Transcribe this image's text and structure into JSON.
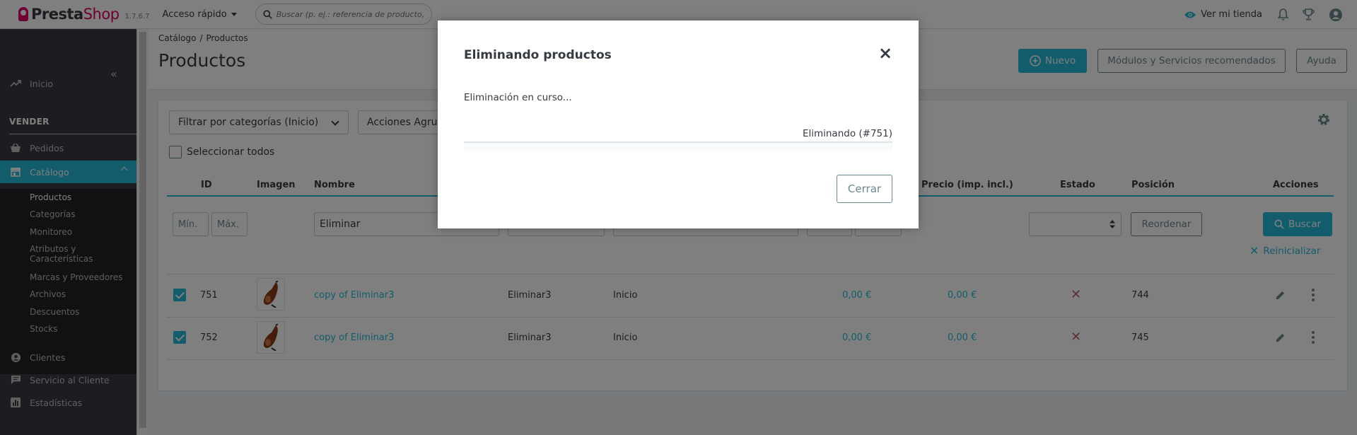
{
  "header": {
    "logo_presta": "Presta",
    "logo_shop": "Shop",
    "version": "1.7.6.7",
    "quick_access": "Acceso rápido",
    "search_placeholder": "Buscar (p. ej.: referencia de producto, n",
    "view_store": "Ver mi tienda"
  },
  "sidebar": {
    "home": "Inicio",
    "section_sell": "VENDER",
    "orders": "Pedidos",
    "catalog": "Catálogo",
    "catalog_sub": [
      "Productos",
      "Categorías",
      "Monitoreo",
      "Atributos y",
      "Características",
      "Marcas y Proveedores",
      "Archivos",
      "Descuentos",
      "Stocks"
    ],
    "customers": "Clientes",
    "customer_service": "Servicio al Cliente",
    "stats": "Estadísticas"
  },
  "page": {
    "breadcrumb": [
      "Catálogo",
      "Productos"
    ],
    "breadcrumb_sep": "/",
    "title": "Productos",
    "new_button": "Nuevo",
    "modules_button": "Módulos y Servicios recomendados",
    "help_button": "Ayuda"
  },
  "toolbar": {
    "category_filter": "Filtrar por categorías (Inicio)",
    "bulk_actions": "Acciones Agrup",
    "select_all": "Seleccionar todos"
  },
  "table": {
    "columns": {
      "id": "ID",
      "image": "Imagen",
      "name": "Nombre",
      "price_incl": "Precio (imp. incl.)",
      "status": "Estado",
      "position": "Posición",
      "actions": "Acciones"
    },
    "filters": {
      "id_min": "Mín.",
      "id_max": "Máx.",
      "name_value": "Eliminar",
      "reorder_button": "Reordenar",
      "search_button": "Buscar",
      "reset_link": "Reinicializar"
    },
    "rows": [
      {
        "id": "751",
        "name": "copy of Eliminar3",
        "reference": "Eliminar3",
        "category": "Inicio",
        "price": "0,00 €",
        "price_incl": "0,00 €",
        "position": "744"
      },
      {
        "id": "752",
        "name": "copy of Eliminar3",
        "reference": "Eliminar3",
        "category": "Inicio",
        "price": "0,00 €",
        "price_incl": "0,00 €",
        "position": "745"
      }
    ]
  },
  "modal": {
    "title": "Eliminando productos",
    "message": "Eliminación en curso...",
    "progress_label": "Eliminando (#751)",
    "progress_percent": 0,
    "close_button": "Cerrar"
  },
  "colors": {
    "accent": "#25b9d7",
    "brand": "#df0067",
    "danger": "#c05c67",
    "sidebar": "#363a41"
  }
}
